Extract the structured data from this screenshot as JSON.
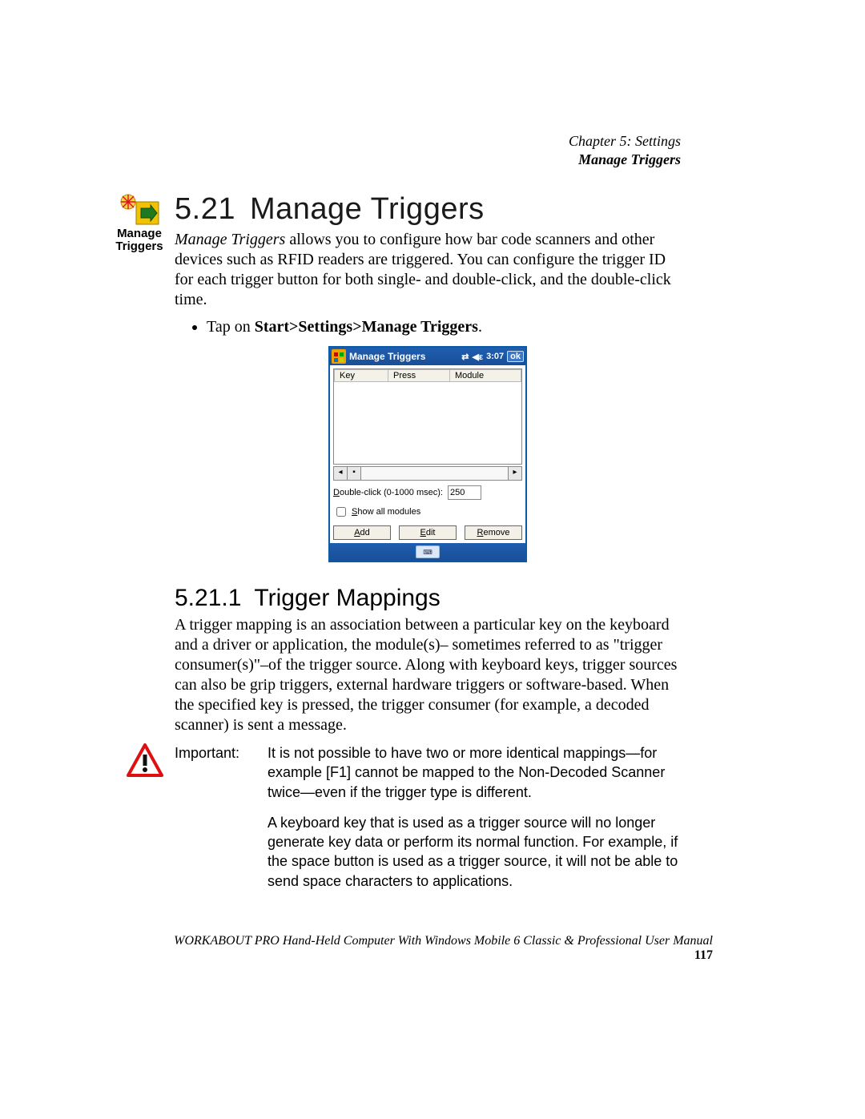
{
  "header": {
    "chapter": "Chapter 5:  Settings",
    "subtitle": "Manage Triggers"
  },
  "margin_icon": {
    "label_line1": "Manage",
    "label_line2": "Triggers"
  },
  "section": {
    "number": "5.21",
    "title": "Manage Triggers",
    "intro_lead": "Manage Triggers",
    "intro_rest": " allows you to configure how bar code scanners and other devices such as RFID readers are triggered. You can configure the trigger ID for each trigger button for both single- and double-click, and the double-click time.",
    "bullet_prefix": "Tap on ",
    "bullet_bold": "Start>Settings>Manage Triggers",
    "bullet_suffix": "."
  },
  "screenshot": {
    "title": "Manage Triggers",
    "time": "3:07",
    "ok": "ok",
    "columns": {
      "c1": "Key",
      "c2": "Press",
      "c3": "Module"
    },
    "dbl_label_u": "D",
    "dbl_label_rest": "ouble-click (0-1000 msec):",
    "dbl_value": "250",
    "show_u": "S",
    "show_rest": "how all modules",
    "btn_add_u": "A",
    "btn_add_rest": "dd",
    "btn_edit_u": "E",
    "btn_edit_rest": "dit",
    "btn_remove_u": "R",
    "btn_remove_rest": "emove"
  },
  "subsection": {
    "number": "5.21.1",
    "title": "Trigger Mappings",
    "text": "A trigger mapping is an association between a particular key on the keyboard and a driver or application, the module(s)– sometimes referred to as \"trigger consumer(s)\"–of the trigger source. Along with keyboard keys, trigger sources can also be grip triggers, external hardware triggers or software-based. When the specified key is pressed, the trigger consumer (for example, a decoded scanner) is sent a message."
  },
  "note": {
    "label": "Important:",
    "p1": "It is not possible to have two or more identical mappings—for example [F1] cannot be mapped to the Non-Decoded Scanner twice—even if the trigger type is different.",
    "p2": "A keyboard key that is used as a trigger source will no longer generate key data or perform its normal function. For example, if the space button is used as a trigger source, it will not be able to send space characters to applications."
  },
  "footer": {
    "text": "WORKABOUT PRO Hand-Held Computer With Windows Mobile 6 Classic & Professional User Manual",
    "page": "117"
  }
}
